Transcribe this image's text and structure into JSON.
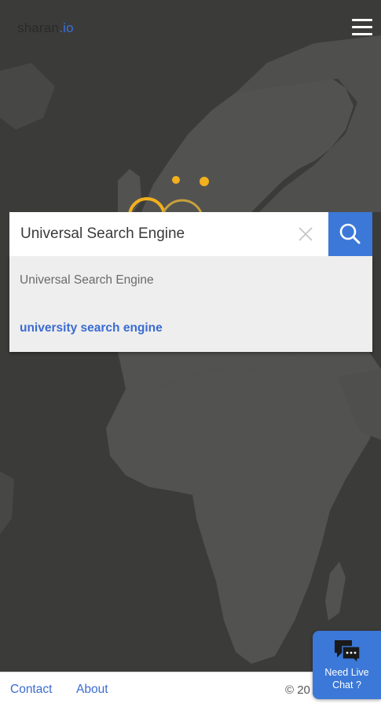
{
  "header": {
    "logo_part1": "sharan",
    "logo_part2": ".io",
    "menu_icon": "hamburger-menu-icon"
  },
  "search": {
    "value": "Universal Search Engine",
    "clear_icon": "close-icon",
    "submit_icon": "search-icon",
    "suggestions": [
      "Universal Search Engine",
      "university search engine"
    ]
  },
  "footer": {
    "links": [
      "Contact",
      "About"
    ],
    "copyright": "© 20"
  },
  "chat": {
    "icon": "chat-bubbles-icon",
    "line1": "Need Live",
    "line2": "Chat ?"
  },
  "colors": {
    "map_background": "#3b3b3a",
    "land": "#525251",
    "accent_blue": "#3b78d8",
    "marker_yellow": "#f2b01e"
  }
}
